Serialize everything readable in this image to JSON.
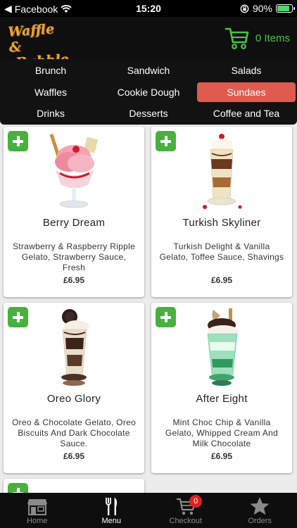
{
  "status_bar": {
    "carrier": "Facebook",
    "time": "15:20",
    "battery": "90%",
    "battery_level": 0.9
  },
  "header": {
    "logo_line1": "Waffle &",
    "logo_line2": "Bubble",
    "cart_count": "0 Items"
  },
  "categories": [
    {
      "label": "Brunch",
      "active": false
    },
    {
      "label": "Sandwich",
      "active": false
    },
    {
      "label": "Salads",
      "active": false
    },
    {
      "label": "Waffles",
      "active": false
    },
    {
      "label": "Cookie Dough",
      "active": false
    },
    {
      "label": "Sundaes",
      "active": true
    },
    {
      "label": "Drinks",
      "active": false
    },
    {
      "label": "Desserts",
      "active": false
    },
    {
      "label": "Coffee and Tea",
      "active": false
    }
  ],
  "products": [
    {
      "name": "Berry Dream",
      "description": "Strawberry & Raspberry Ripple Gelato, Strawberry Sauce, Fresh",
      "price": "£6.95"
    },
    {
      "name": "Turkish Skyliner",
      "description": "Turkish Delight & Vanilla Gelato, Toffee Sauce, Shavings",
      "price": "£6.95"
    },
    {
      "name": "Oreo Glory",
      "description": "Oreo & Chocolate Gelato, Oreo Biscuits And Dark Chocolate Sauce.",
      "price": "£6.95"
    },
    {
      "name": "After Eight",
      "description": "Mint Choc Chip & Vanilla Gelato, Whipped Cream And Milk Chocolate",
      "price": "£6.95"
    }
  ],
  "tab_bar": {
    "home": "Home",
    "menu": "Menu",
    "checkout": "Checkout",
    "checkout_badge": "0",
    "orders": "Orders"
  },
  "colors": {
    "accent": "#e05a4e",
    "cart_green": "#4cc24c",
    "add_green": "#48b13d",
    "logo": "#e8a43a"
  }
}
